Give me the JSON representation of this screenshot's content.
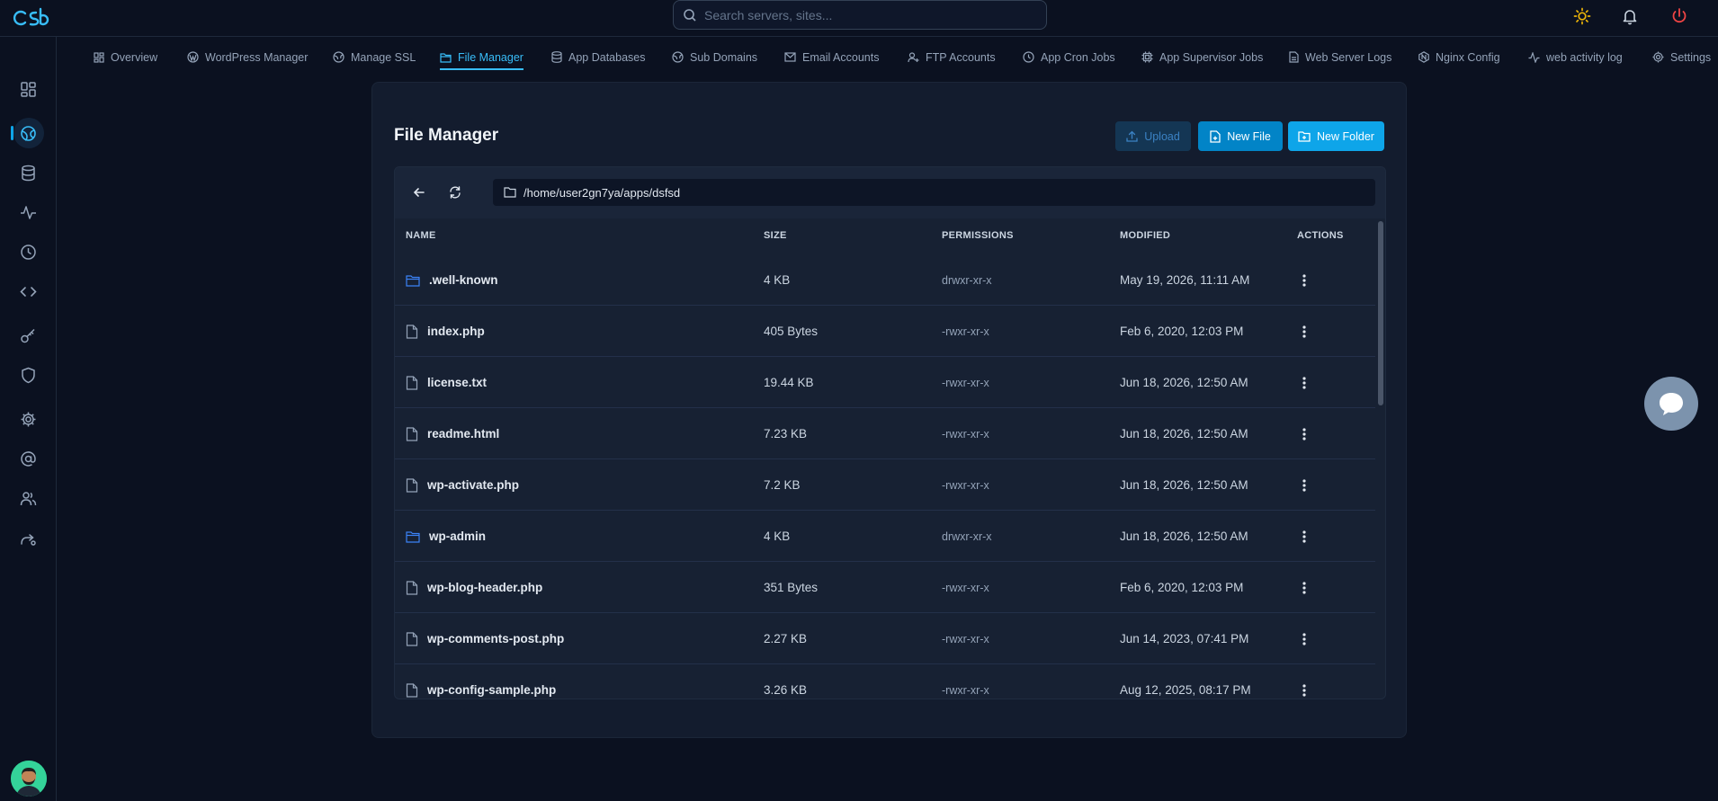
{
  "search": {
    "placeholder": "Search servers, sites..."
  },
  "tabs": [
    {
      "label": "Overview"
    },
    {
      "label": "WordPress Manager"
    },
    {
      "label": "Manage SSL"
    },
    {
      "label": "File Manager"
    },
    {
      "label": "App Databases"
    },
    {
      "label": "Sub Domains"
    },
    {
      "label": "Email Accounts"
    },
    {
      "label": "FTP Accounts"
    },
    {
      "label": "App Cron Jobs"
    },
    {
      "label": "App Supervisor Jobs"
    },
    {
      "label": "Web Server Logs"
    },
    {
      "label": "Nginx Config"
    },
    {
      "label": "web activity log"
    },
    {
      "label": "Settings"
    }
  ],
  "file_manager": {
    "title": "File Manager",
    "upload_label": "Upload",
    "new_file_label": "New File",
    "new_folder_label": "New Folder",
    "path": "/home/user2gn7ya/apps/dsfsd",
    "columns": {
      "name": "NAME",
      "size": "SIZE",
      "permissions": "PERMISSIONS",
      "modified": "MODIFIED",
      "actions": "ACTIONS"
    },
    "files": [
      {
        "name": ".well-known",
        "type": "folder",
        "size": "4 KB",
        "permissions": "drwxr-xr-x",
        "modified": "May 19, 2026, 11:11 AM"
      },
      {
        "name": "index.php",
        "type": "file",
        "size": "405 Bytes",
        "permissions": "-rwxr-xr-x",
        "modified": "Feb 6, 2020, 12:03 PM"
      },
      {
        "name": "license.txt",
        "type": "file",
        "size": "19.44 KB",
        "permissions": "-rwxr-xr-x",
        "modified": "Jun 18, 2026, 12:50 AM"
      },
      {
        "name": "readme.html",
        "type": "file",
        "size": "7.23 KB",
        "permissions": "-rwxr-xr-x",
        "modified": "Jun 18, 2026, 12:50 AM"
      },
      {
        "name": "wp-activate.php",
        "type": "file",
        "size": "7.2 KB",
        "permissions": "-rwxr-xr-x",
        "modified": "Jun 18, 2026, 12:50 AM"
      },
      {
        "name": "wp-admin",
        "type": "folder",
        "size": "4 KB",
        "permissions": "drwxr-xr-x",
        "modified": "Jun 18, 2026, 12:50 AM"
      },
      {
        "name": "wp-blog-header.php",
        "type": "file",
        "size": "351 Bytes",
        "permissions": "-rwxr-xr-x",
        "modified": "Feb 6, 2020, 12:03 PM"
      },
      {
        "name": "wp-comments-post.php",
        "type": "file",
        "size": "2.27 KB",
        "permissions": "-rwxr-xr-x",
        "modified": "Jun 14, 2023, 07:41 PM"
      },
      {
        "name": "wp-config-sample.php",
        "type": "file",
        "size": "3.26 KB",
        "permissions": "-rwxr-xr-x",
        "modified": "Aug 12, 2025, 08:17 PM"
      }
    ]
  },
  "colors": {
    "accent": "#0ea5e9",
    "background": "#0b1120",
    "card": "#131c2e",
    "danger": "#ef4444",
    "sun": "#eab308"
  },
  "icons": {
    "theme_toggle": "sun-icon",
    "notifications": "bell-icon",
    "logout": "power-icon",
    "chat": "chat-icon"
  }
}
